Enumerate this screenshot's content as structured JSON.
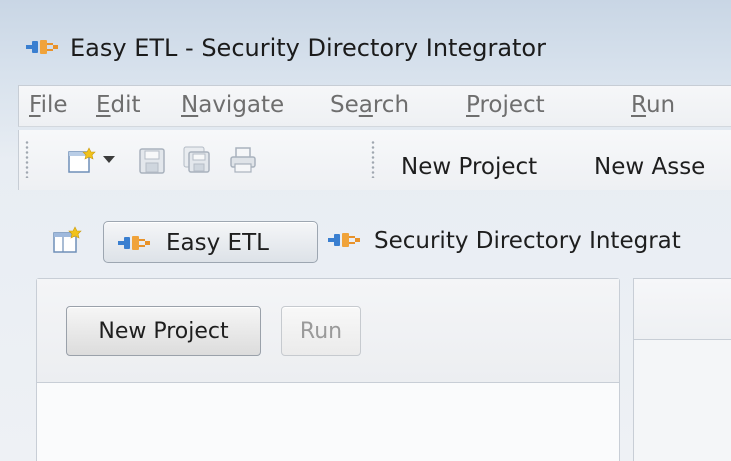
{
  "window": {
    "title": "Easy ETL - Security Directory Integrator",
    "app_icon": "plug-connector-icon"
  },
  "menubar": {
    "items": [
      {
        "label": "File",
        "mnemonic": "F",
        "rest": "ile"
      },
      {
        "label": "Edit",
        "mnemonic": "E",
        "rest": "dit"
      },
      {
        "label": "Navigate",
        "mnemonic": "N",
        "rest": "avigate"
      },
      {
        "label": "Search",
        "pre": "Se",
        "mnemonic": "a",
        "rest": "rch"
      },
      {
        "label": "Project",
        "mnemonic": "P",
        "rest": "roject"
      },
      {
        "label": "Run",
        "mnemonic": "R",
        "rest": "un"
      }
    ]
  },
  "toolbar": {
    "icons": [
      "new-wizard-icon",
      "dropdown-arrow-icon",
      "save-icon",
      "save-all-icon",
      "print-icon"
    ],
    "new_project_label": "New Project",
    "new_assembly_label": "New Asse"
  },
  "perspectives": {
    "open_perspective_icon": "open-perspective-icon",
    "active_label": "Easy ETL",
    "other_label": "Security Directory Integrat"
  },
  "left_panel": {
    "new_project_button": "New Project",
    "run_button": "Run"
  },
  "colors": {
    "accent_plug_blue": "#3a7fd0",
    "accent_plug_orange": "#e8922a",
    "disabled_text": "#9a9a9a"
  }
}
